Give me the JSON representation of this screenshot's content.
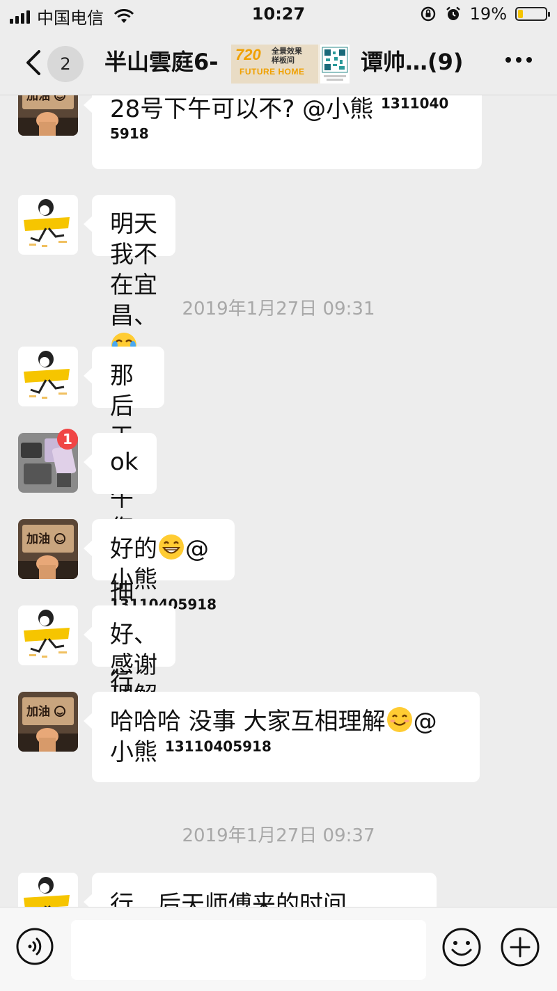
{
  "status_bar": {
    "carrier": "中国电信",
    "time": "10:27",
    "battery": "19%",
    "battery_level": 0.19
  },
  "nav": {
    "unread_count": "2",
    "title_left": "半山雲庭6-",
    "title_right": "谭帅…(9)",
    "ad": {
      "number": "720",
      "line1": "全景效果",
      "line2": "样板间",
      "brand": "FUTURE HOME"
    }
  },
  "messages": [
    {
      "avatar": "sign-avatar",
      "text": "28号下午可以不? @小熊 ",
      "num_a": "1311040",
      "num_b": "5918"
    },
    {
      "avatar": "runner-avatar",
      "text": "明天我不在宜昌、"
    },
    {
      "timestamp": "2019年1月27日 09:31"
    },
    {
      "avatar": "runner-avatar",
      "text": "那后天上午您们抽个空行不?"
    },
    {
      "avatar": "photo-avatar",
      "badge": "1",
      "text": "ok"
    },
    {
      "avatar": "sign-avatar",
      "text_a": "好的",
      "text_b": "@小熊 ",
      "num": "13110405918"
    },
    {
      "avatar": "runner-avatar",
      "text": "好、感谢理解"
    },
    {
      "avatar": "sign-avatar",
      "text_a": "哈哈哈 没事 大家互相理解",
      "text_b": "@",
      "text_c": "小熊 ",
      "num": "13110405918"
    },
    {
      "timestamp": "2019年1月27日 09:37"
    },
    {
      "avatar": "runner-avatar",
      "text": "行，后天师傅来的时间"
    }
  ],
  "avatar_sign_text": "加油",
  "icons": {
    "back": "chevron-left-icon",
    "more": "more-dots-icon",
    "voice": "voice-icon",
    "emoji": "emoji-icon",
    "plus": "plus-icon"
  },
  "colors": {
    "background": "#ededed",
    "bubble": "#ffffff",
    "badge": "#f04545",
    "battery": "#f5c400"
  }
}
